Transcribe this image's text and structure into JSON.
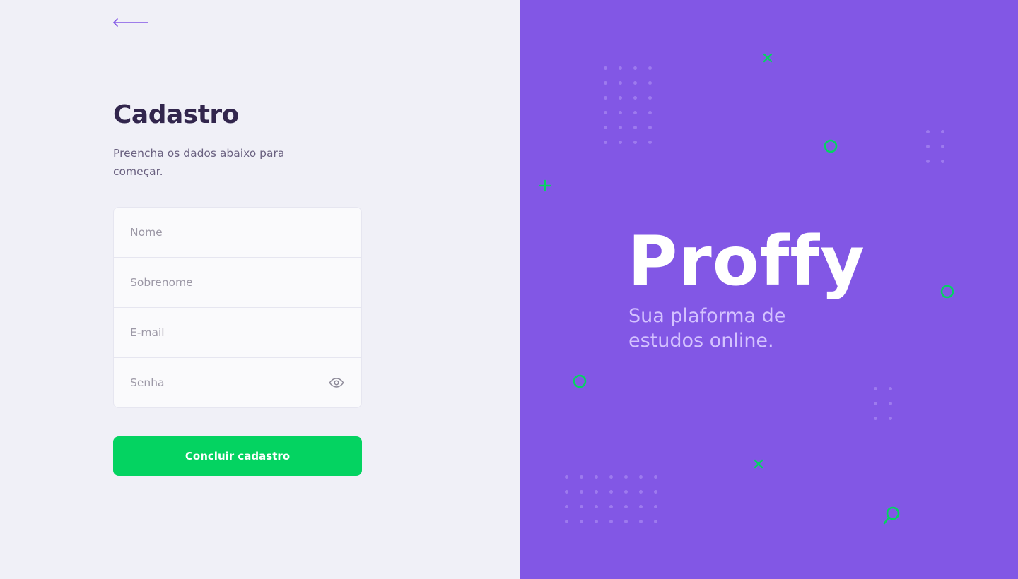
{
  "register": {
    "back_label": "Voltar",
    "title": "Cadastro",
    "subtitle": "Preencha os dados abaixo para começar.",
    "fields": {
      "first_name_placeholder": "Nome",
      "last_name_placeholder": "Sobrenome",
      "email_placeholder": "E-mail",
      "password_placeholder": "Senha"
    },
    "submit_label": "Concluir cadastro"
  },
  "brand": {
    "logo_text": "Proffy",
    "tagline": "Sua plaforma de estudos online."
  },
  "colors": {
    "accent_purple": "#8257E5",
    "accent_green": "#04D361",
    "title_text": "#32264D",
    "body_text": "#6A6180",
    "placeholder_text": "#9C98A6"
  },
  "icons": {
    "back": "arrow-left-icon",
    "password_toggle": "eye-icon"
  }
}
